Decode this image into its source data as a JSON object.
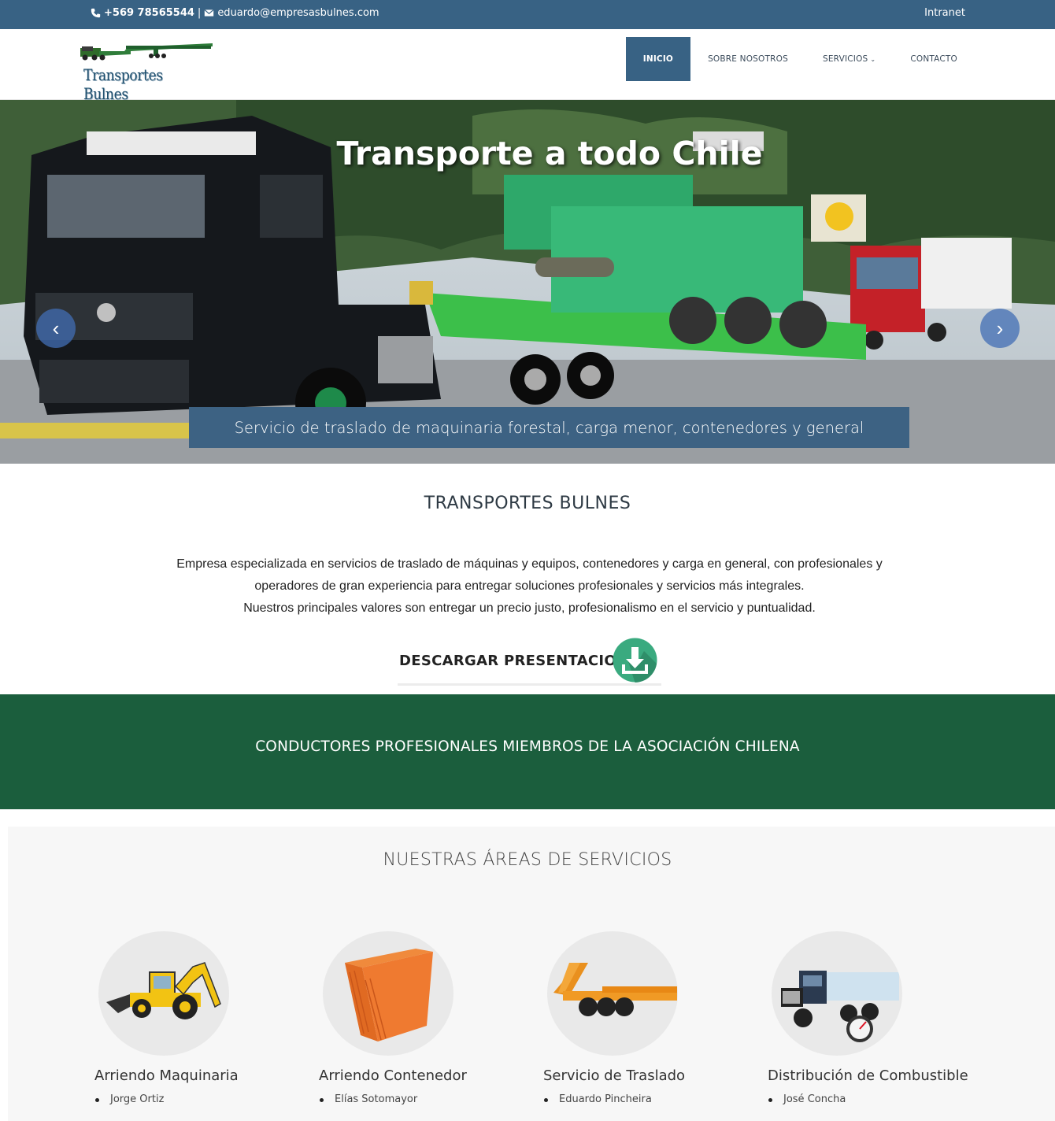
{
  "topbar": {
    "phone": "+569 78565544",
    "separator": "|",
    "email": "eduardo@empresasbulnes.com",
    "intranet": "Intranet",
    "icons": [
      "phone-icon",
      "envelope-icon"
    ]
  },
  "header": {
    "logo_text": "Transportes Bulnes",
    "nav": [
      {
        "label": "INICIO",
        "active": true
      },
      {
        "label": "SOBRE NOSOTROS",
        "active": false
      },
      {
        "label": "SERVICIOS",
        "active": false,
        "has_dropdown": true
      },
      {
        "label": "CONTACTO",
        "active": false
      }
    ]
  },
  "hero": {
    "title": "Transporte a todo Chile",
    "caption": "Servicio de traslado de maquinaria forestal, carga menor, contenedores y general",
    "prev_arrow": "‹",
    "next_arrow": "›"
  },
  "about": {
    "title": "TRANSPORTES BULNES",
    "line1": "Empresa especializada en servicios de traslado de máquinas y equipos, contenedores y carga en general, con profesionales y",
    "line2": "operadores de gran experiencia para entregar soluciones profesionales y servicios más integrales.",
    "line3": "Nuestros principales valores son entregar un precio justo, profesionalismo en el servicio y puntualidad.",
    "download_label": "DESCARGAR PRESENTACION"
  },
  "banner": {
    "text": "CONDUCTORES PROFESIONALES MIEMBROS DE LA ASOCIACIÓN CHILENA"
  },
  "services": {
    "title": "NUESTRAS ÁREAS DE SERVICIOS",
    "items": [
      {
        "name": "Arriendo Maquinaria",
        "contact": "Jorge Ortiz",
        "icon": "backhoe-icon"
      },
      {
        "name": "Arriendo Contenedor",
        "contact": "Elías Sotomayor",
        "icon": "container-icon"
      },
      {
        "name": "Servicio de Traslado",
        "contact": "Eduardo Pincheira",
        "icon": "lowboy-trailer-icon"
      },
      {
        "name": "Distribución de Combustible",
        "contact": "José Concha",
        "icon": "fuel-truck-icon"
      }
    ]
  },
  "colors": {
    "topbar": "#386284",
    "nav_active": "#386284",
    "banner": "#1b5e3d",
    "download_icon": "#3aaa7f"
  }
}
